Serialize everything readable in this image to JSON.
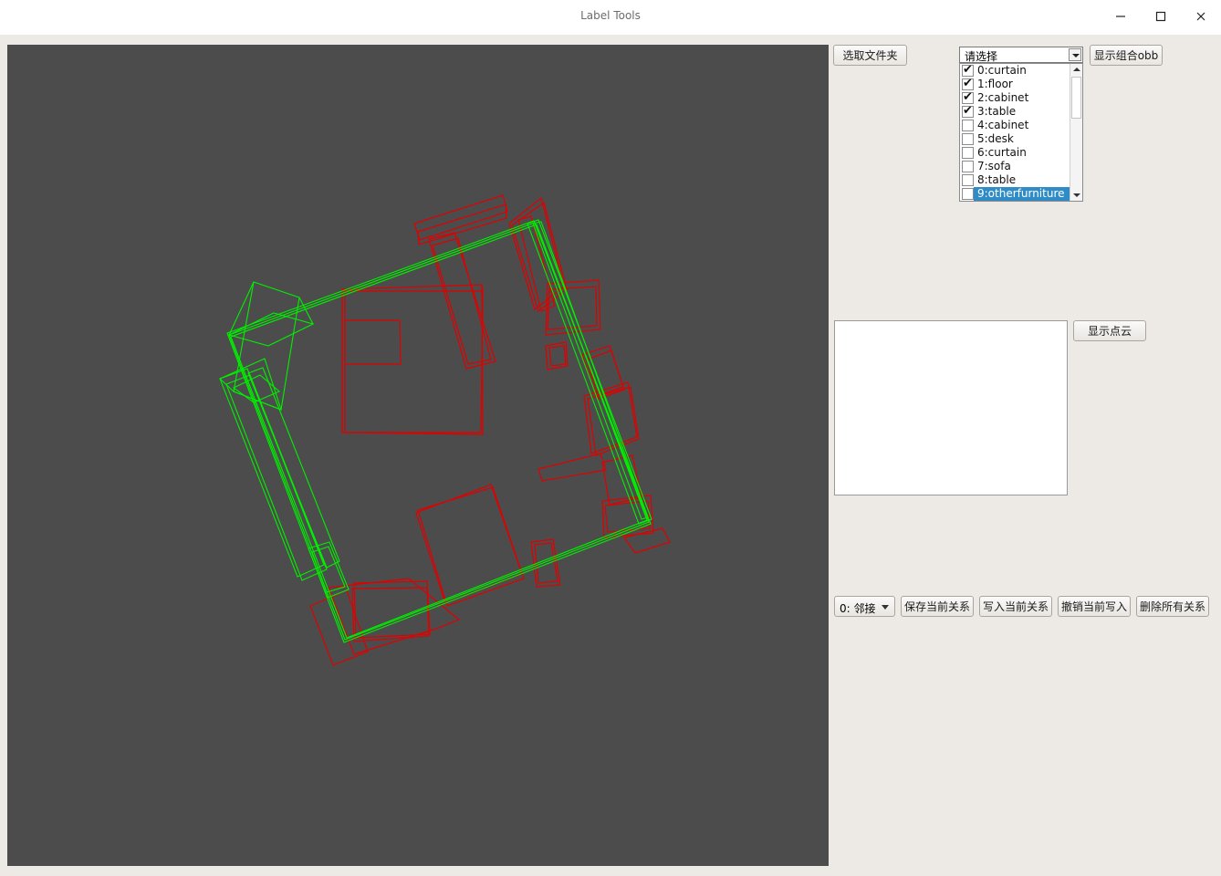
{
  "window": {
    "title": "Label Tools",
    "minimize_icon": "minimize-icon",
    "maximize_icon": "maximize-icon",
    "close_icon": "close-icon"
  },
  "toolbar": {
    "select_folder": "选取文件夹",
    "show_group_obb": "显示组合obb",
    "show_point_cloud": "显示点云"
  },
  "category_combo": {
    "selected": "请选择",
    "options": [
      {
        "label": "0:curtain",
        "checked": true
      },
      {
        "label": "1:floor",
        "checked": true
      },
      {
        "label": "2:cabinet",
        "checked": true
      },
      {
        "label": "3:table",
        "checked": true
      },
      {
        "label": "4:cabinet",
        "checked": false
      },
      {
        "label": "5:desk",
        "checked": false
      },
      {
        "label": "6:curtain",
        "checked": false
      },
      {
        "label": "7:sofa",
        "checked": false
      },
      {
        "label": "8:table",
        "checked": false
      },
      {
        "label": "9:otherfurniture",
        "checked": false,
        "highlighted": true
      }
    ]
  },
  "relations": {
    "type_selected": "0: 邻接",
    "save_current": "保存当前关系",
    "write_current": "写入当前关系",
    "undo_write": "撤销当前写入",
    "delete_all": "删除所有关系"
  },
  "viewport": {
    "background": "#4c4c4c",
    "selected_box_color": "#00ff00",
    "unselected_box_color": "#ff0000"
  }
}
